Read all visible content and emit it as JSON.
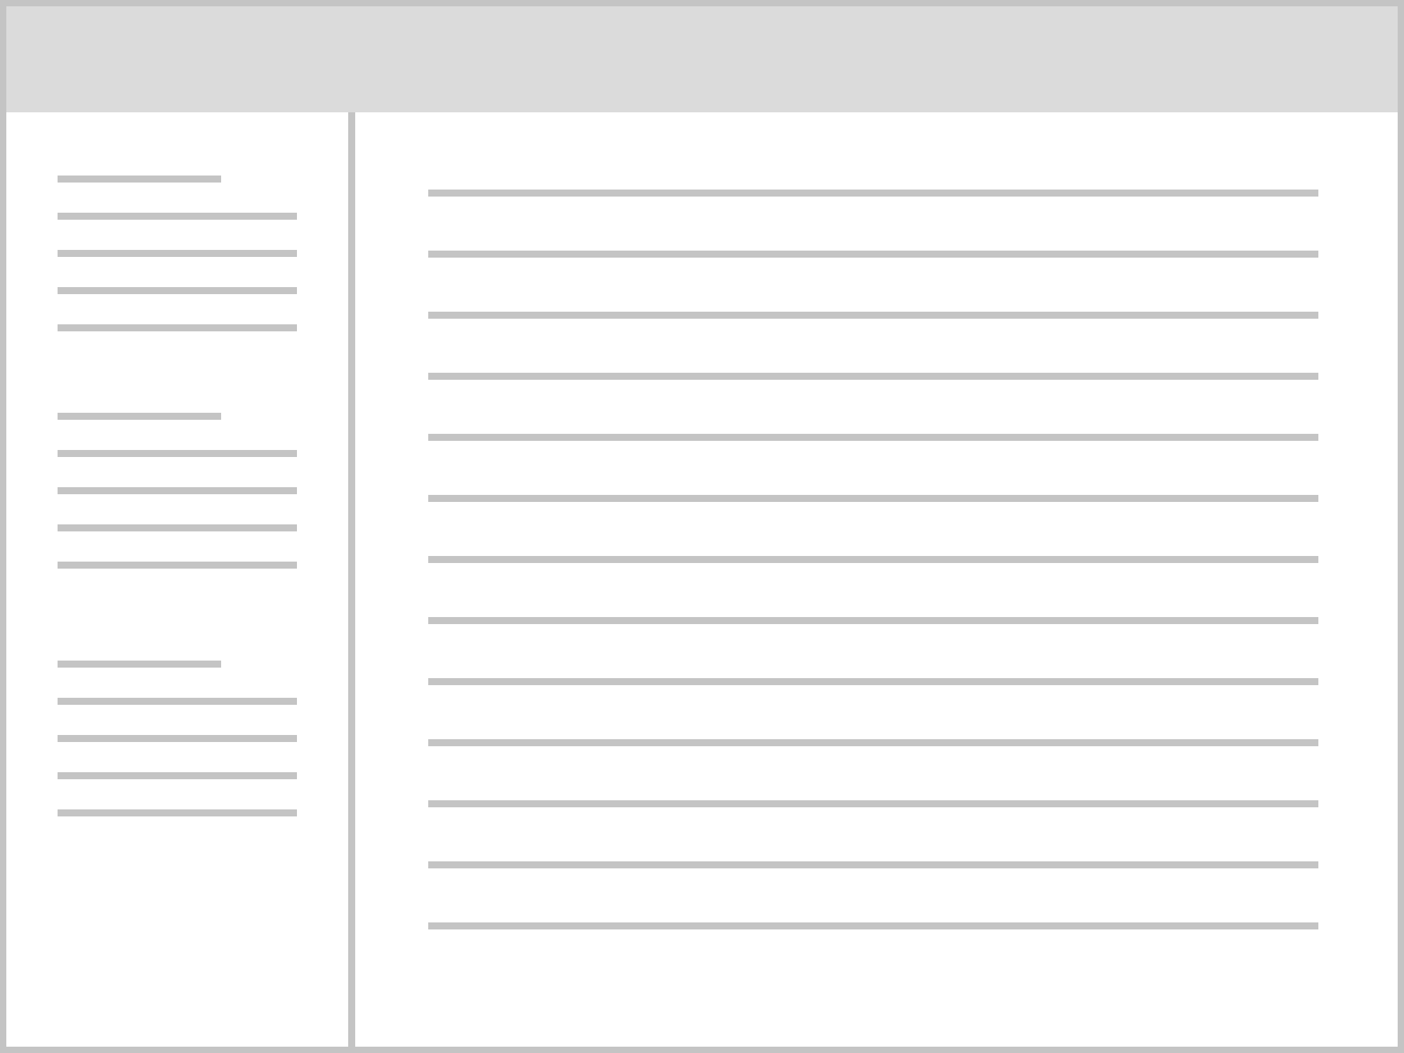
{
  "colors": {
    "frame": "#c4c4c4",
    "header": "#dbdbdb",
    "placeholder_line": "#c4c4c4",
    "background": "#ffffff"
  },
  "sidebar": {
    "groups": [
      {
        "heading_lines": 1,
        "item_lines": 4
      },
      {
        "heading_lines": 1,
        "item_lines": 4
      },
      {
        "heading_lines": 1,
        "item_lines": 4
      }
    ]
  },
  "main": {
    "content_lines": 13
  }
}
